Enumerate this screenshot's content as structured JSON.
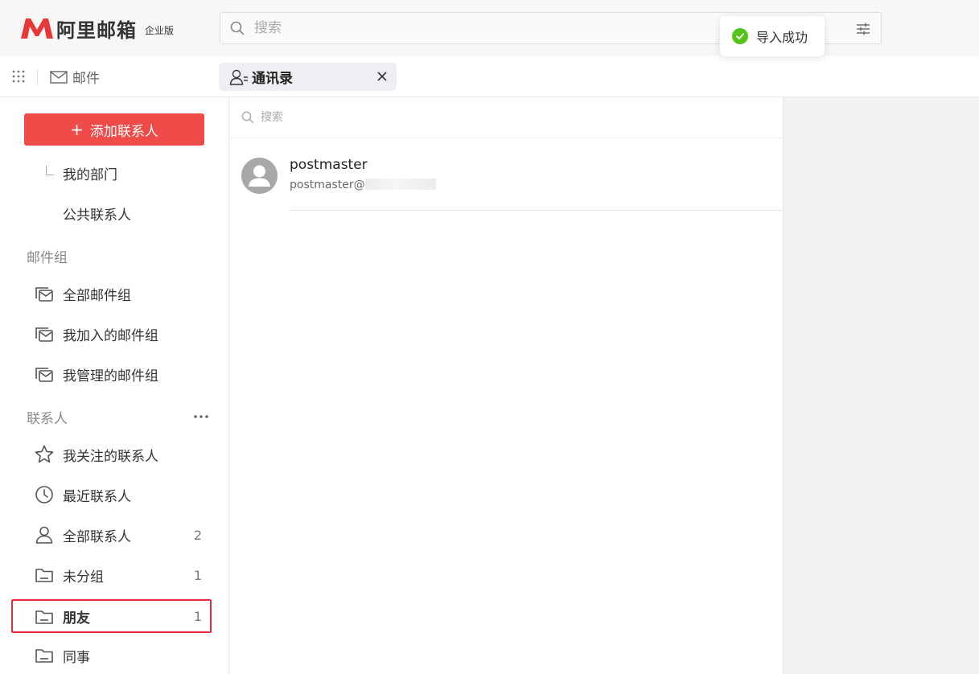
{
  "brand": {
    "name": "阿里邮箱",
    "edition": "企业版",
    "color": "#e83737"
  },
  "header": {
    "search_placeholder": "搜索"
  },
  "toast": {
    "message": "导入成功",
    "color": "#52c41a"
  },
  "tabbar": {
    "mail_label": "邮件",
    "active_tab": {
      "label": "通讯录",
      "icon": "contacts-icon"
    }
  },
  "sidebar": {
    "add_button_label": "添加联系人",
    "add_button_color": "#ef4b48",
    "org_items": [
      {
        "label": "我的部门"
      },
      {
        "label": "公共联系人"
      }
    ],
    "mail_group_title": "邮件组",
    "mail_groups": [
      {
        "label": "全部邮件组",
        "icon": "mail-group-icon"
      },
      {
        "label": "我加入的邮件组",
        "icon": "mail-group-icon"
      },
      {
        "label": "我管理的邮件组",
        "icon": "mail-group-icon"
      }
    ],
    "contacts_title": "联系人",
    "contacts": [
      {
        "label": "我关注的联系人",
        "icon": "star-icon",
        "count": ""
      },
      {
        "label": "最近联系人",
        "icon": "clock-icon",
        "count": ""
      },
      {
        "label": "全部联系人",
        "icon": "user-icon",
        "count": "2"
      },
      {
        "label": "未分组",
        "icon": "folder-icon",
        "count": "1"
      },
      {
        "label": "朋友",
        "icon": "folder-icon",
        "count": "1",
        "selected": true
      },
      {
        "label": "同事",
        "icon": "folder-icon",
        "count": ""
      }
    ]
  },
  "list": {
    "search_placeholder": "搜索",
    "contacts": [
      {
        "name": "postmaster",
        "email": "postmaster@"
      }
    ]
  }
}
